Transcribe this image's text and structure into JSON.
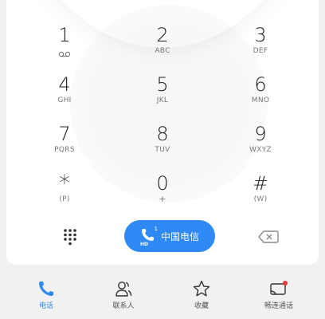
{
  "keypad": {
    "keys": [
      {
        "digit": "1",
        "letters": "",
        "icon": "voicemail-icon"
      },
      {
        "digit": "2",
        "letters": "ABC"
      },
      {
        "digit": "3",
        "letters": "DEF"
      },
      {
        "digit": "4",
        "letters": "GHI"
      },
      {
        "digit": "5",
        "letters": "JKL"
      },
      {
        "digit": "6",
        "letters": "MNO"
      },
      {
        "digit": "7",
        "letters": "PQRS"
      },
      {
        "digit": "8",
        "letters": "TUV"
      },
      {
        "digit": "9",
        "letters": "WXYZ"
      },
      {
        "digit": "*",
        "letters": "(P)"
      },
      {
        "digit": "0",
        "letters": "+"
      },
      {
        "digit": "#",
        "letters": "(W)"
      }
    ]
  },
  "actions": {
    "call_label": "中国电信",
    "call_badge_sim": "1",
    "call_badge_hd": "HD",
    "call_color": "#2e89f5"
  },
  "tabs": [
    {
      "label": "电话",
      "icon": "phone-icon",
      "active": true
    },
    {
      "label": "联系人",
      "icon": "contacts-icon",
      "active": false
    },
    {
      "label": "收藏",
      "icon": "star-icon",
      "active": false
    },
    {
      "label": "畅连通话",
      "icon": "video-call-icon",
      "active": false
    }
  ],
  "colors": {
    "accent": "#2e89f5",
    "notification_dot": "#e53935"
  }
}
